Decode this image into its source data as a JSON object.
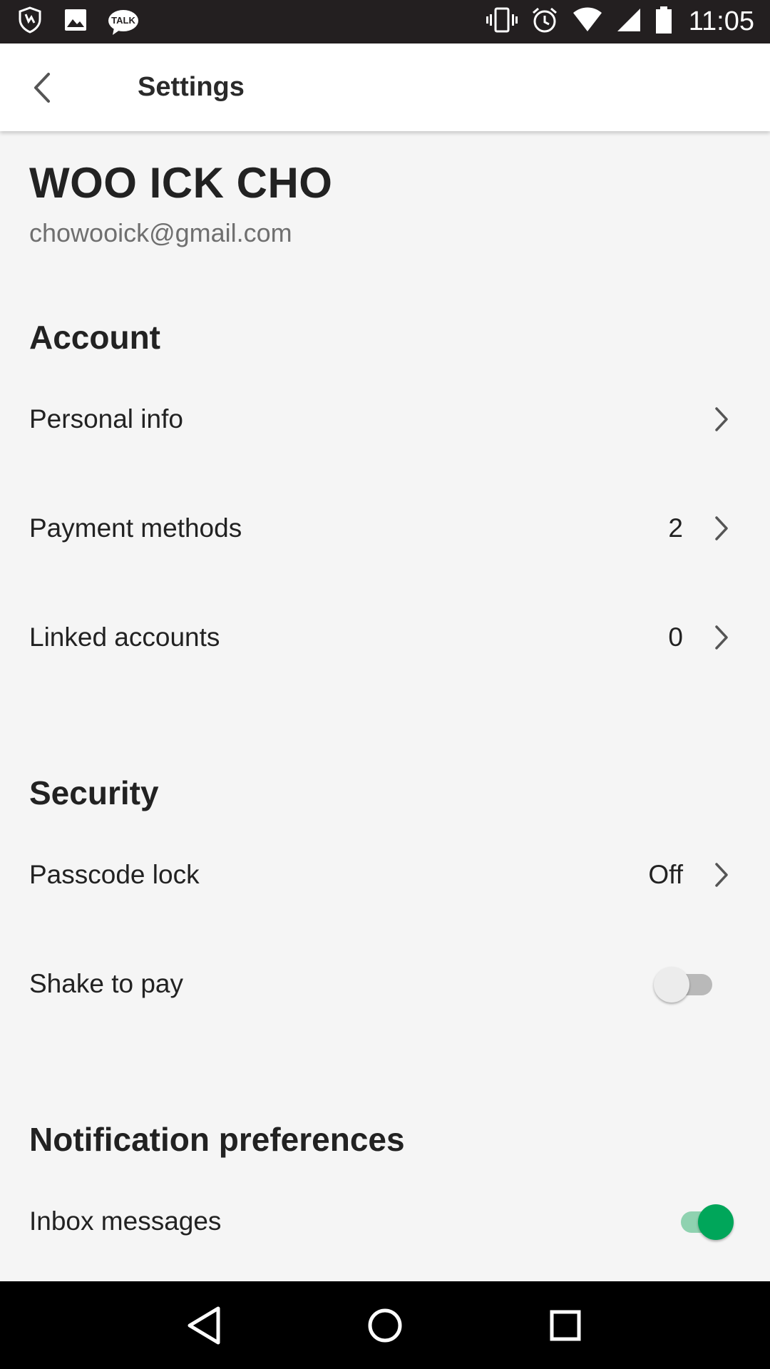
{
  "status_bar": {
    "time": "11:05",
    "left_icons": [
      "shield-icon",
      "image-icon",
      "talk-icon"
    ],
    "talk_badge": "TALK",
    "right_icons": [
      "vibrate-icon",
      "alarm-icon",
      "wifi-icon",
      "signal-icon",
      "battery-icon"
    ]
  },
  "app_bar": {
    "title": "Settings",
    "back_icon": "back-arrow-icon"
  },
  "profile": {
    "name": "WOO ICK CHO",
    "email": "chowooick@gmail.com"
  },
  "account": {
    "title": "Account",
    "items": [
      {
        "label": "Personal info",
        "value": ""
      },
      {
        "label": "Payment methods",
        "value": "2"
      },
      {
        "label": "Linked accounts",
        "value": "0"
      }
    ]
  },
  "security": {
    "title": "Security",
    "passcode": {
      "label": "Passcode lock",
      "value": "Off"
    },
    "shake": {
      "label": "Shake to pay",
      "enabled": false
    }
  },
  "notifications": {
    "title": "Notification preferences",
    "inbox": {
      "label": "Inbox messages",
      "enabled": true
    }
  },
  "colors": {
    "toggle_on": "#00a65a",
    "status_bar_bg": "#231f20",
    "page_bg": "#f5f5f5"
  },
  "nav_bar": {
    "icons": [
      "nav-back-icon",
      "nav-home-icon",
      "nav-recents-icon"
    ]
  }
}
